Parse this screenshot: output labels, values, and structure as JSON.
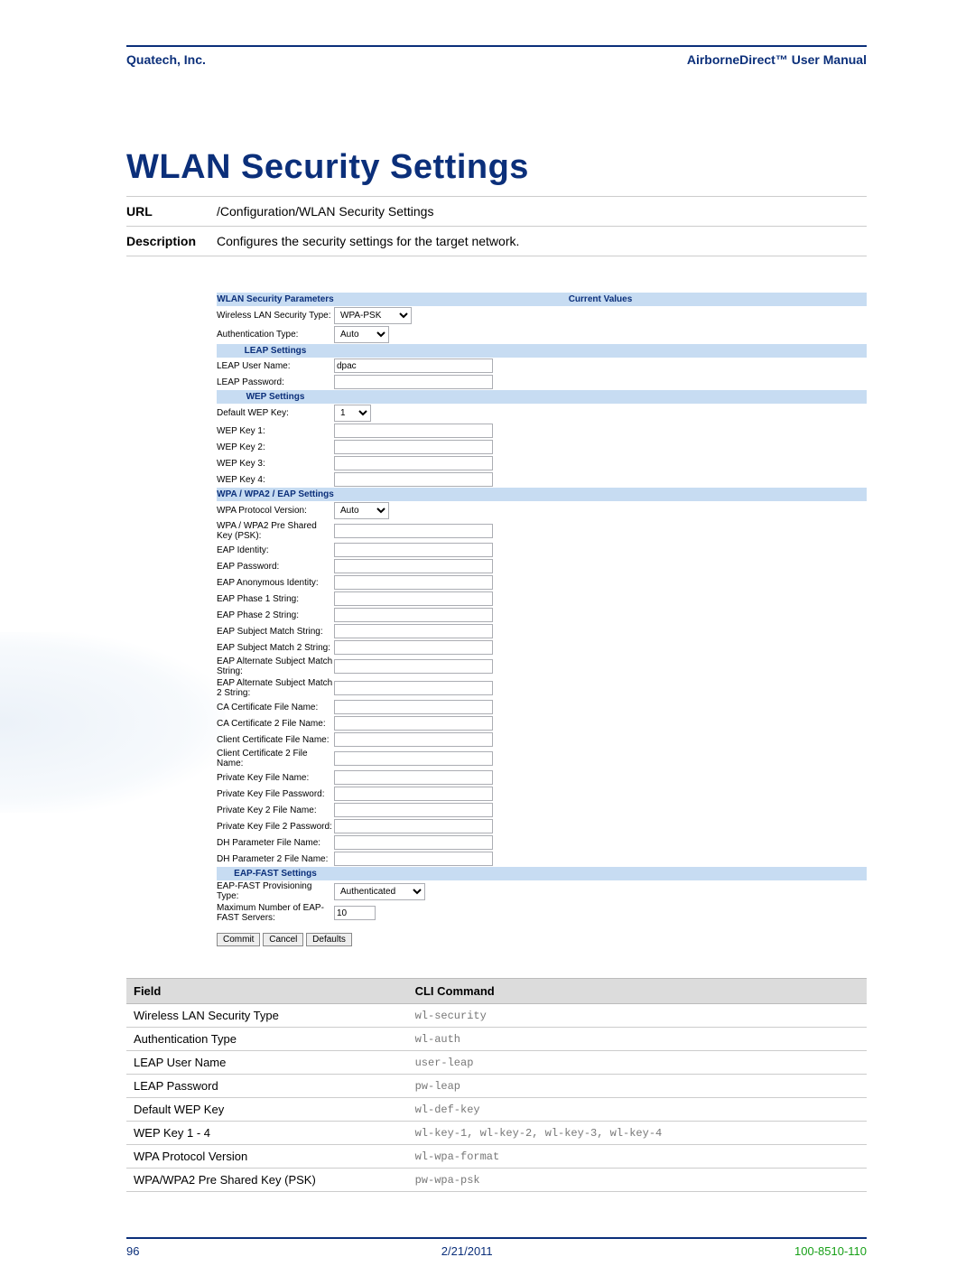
{
  "header": {
    "company": "Quatech, Inc.",
    "manual": "AirborneDirect™ User Manual"
  },
  "title": "WLAN Security Settings",
  "meta": {
    "url_label": "URL",
    "url_value": "/Configuration/WLAN Security Settings",
    "desc_label": "Description",
    "desc_value": "Configures the security settings for the target network."
  },
  "form": {
    "head_params": "WLAN Security Parameters",
    "head_values": "Current Values",
    "sec_type_label": "Wireless LAN Security Type:",
    "sec_type_value": "WPA-PSK",
    "auth_type_label": "Authentication Type:",
    "auth_type_value": "Auto",
    "leap_head": "LEAP Settings",
    "leap_user_label": "LEAP User Name:",
    "leap_user_value": "dpac",
    "leap_pw_label": "LEAP Password:",
    "wep_head": "WEP Settings",
    "wep_default_label": "Default WEP Key:",
    "wep_default_value": "1",
    "wep1_label": "WEP Key 1:",
    "wep2_label": "WEP Key 2:",
    "wep3_label": "WEP Key 3:",
    "wep4_label": "WEP Key 4:",
    "wpa_head": "WPA / WPA2 / EAP Settings",
    "wpa_proto_label": "WPA Protocol Version:",
    "wpa_proto_value": "Auto",
    "psk_label": "WPA / WPA2 Pre Shared Key (PSK):",
    "eap_id_label": "EAP Identity:",
    "eap_pw_label": "EAP Password:",
    "eap_anon_label": "EAP Anonymous Identity:",
    "eap_p1_label": "EAP Phase 1 String:",
    "eap_p2_label": "EAP Phase 2 String:",
    "eap_sm_label": "EAP Subject Match String:",
    "eap_sm2_label": "EAP Subject Match 2 String:",
    "eap_asm_label": "EAP Alternate Subject Match String:",
    "eap_asm2_label": "EAP Alternate Subject Match 2 String:",
    "ca_label": "CA Certificate File Name:",
    "ca2_label": "CA Certificate 2 File Name:",
    "client_cert_label": "Client Certificate File Name:",
    "client_cert2_label": "Client Certificate 2 File Name:",
    "pk_label": "Private Key File Name:",
    "pk_pw_label": "Private Key File Password:",
    "pk2_label": "Private Key 2 File Name:",
    "pk2_pw_label": "Private Key File 2 Password:",
    "dh_label": "DH Parameter File Name:",
    "dh2_label": "DH Parameter 2 File Name:",
    "eapfast_head": "EAP-FAST Settings",
    "eapfast_prov_label": "EAP-FAST Provisioning Type:",
    "eapfast_prov_value": "Authenticated",
    "eapfast_max_label": "Maximum Number of EAP-FAST Servers:",
    "eapfast_max_value": "10",
    "btn_commit": "Commit",
    "btn_cancel": "Cancel",
    "btn_defaults": "Defaults"
  },
  "cli": {
    "h_field": "Field",
    "h_cmd": "CLI Command",
    "rows": [
      {
        "f": "Wireless LAN Security Type",
        "c": "wl-security"
      },
      {
        "f": "Authentication Type",
        "c": "wl-auth"
      },
      {
        "f": "LEAP User Name",
        "c": "user-leap"
      },
      {
        "f": "LEAP Password",
        "c": "pw-leap"
      },
      {
        "f": "Default WEP Key",
        "c": "wl-def-key"
      },
      {
        "f": "WEP Key 1 - 4",
        "c": "wl-key-1, wl-key-2, wl-key-3, wl-key-4"
      },
      {
        "f": "WPA Protocol Version",
        "c": "wl-wpa-format"
      },
      {
        "f": "WPA/WPA2 Pre Shared Key (PSK)",
        "c": "pw-wpa-psk"
      }
    ]
  },
  "footer": {
    "page": "96",
    "date": "2/21/2011",
    "docno": "100-8510-110"
  }
}
